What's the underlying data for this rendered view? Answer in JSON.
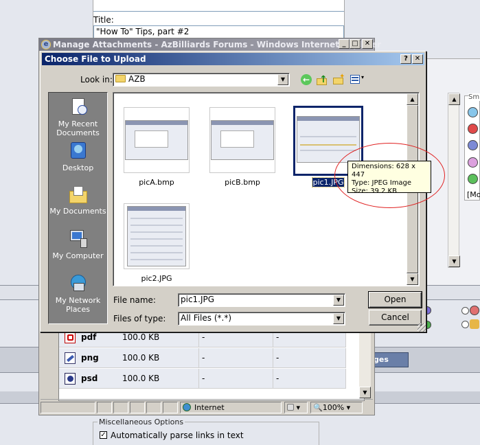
{
  "background": {
    "title_label": "Title:",
    "title_value": "\"How To\" Tips, part #2",
    "smilies_label": "Smi",
    "smilies_more": "[Mo",
    "update_button": "ges",
    "misc_legend": "Miscellaneous Options",
    "auto_parse_label": "Automatically parse links in text"
  },
  "ie_window": {
    "title": "Manage Attachments - AzBilliards Forums - Windows Internet Explorer",
    "rows": [
      {
        "ext": "pdf",
        "size": "100.0 KB",
        "col3": "-",
        "col4": "-"
      },
      {
        "ext": "png",
        "size": "100.0 KB",
        "col3": "-",
        "col4": "-"
      },
      {
        "ext": "psd",
        "size": "100.0 KB",
        "col3": "-",
        "col4": "-"
      }
    ],
    "status_zone": "Internet",
    "zoom": "100%"
  },
  "dialog": {
    "title": "Choose File to Upload",
    "look_in_label": "Look in:",
    "look_in_value": "AZB",
    "places": [
      {
        "label": "My Recent Documents"
      },
      {
        "label": "Desktop"
      },
      {
        "label": "My Documents"
      },
      {
        "label": "My Computer"
      },
      {
        "label": "My Network Places"
      }
    ],
    "files": [
      {
        "name": "picA.bmp"
      },
      {
        "name": "picB.bmp"
      },
      {
        "name": "pic1.JPG"
      },
      {
        "name": "pic2.JPG"
      }
    ],
    "tooltip": {
      "dimensions": "Dimensions: 628 x 447",
      "type": "Type: JPEG Image",
      "size": "Size: 39.2 KB"
    },
    "file_name_label": "File name:",
    "file_name_value": "pic1.JPG",
    "file_type_label": "Files of type:",
    "file_type_value": "All Files (*.*)",
    "open_button": "Open",
    "cancel_button": "Cancel"
  },
  "colors": {
    "dialog_title_start": "#0a246a",
    "dialog_title_end": "#a6caf0",
    "selection": "#0a246a",
    "annotation": "#e02020",
    "tooltip_bg": "#ffffe1"
  }
}
